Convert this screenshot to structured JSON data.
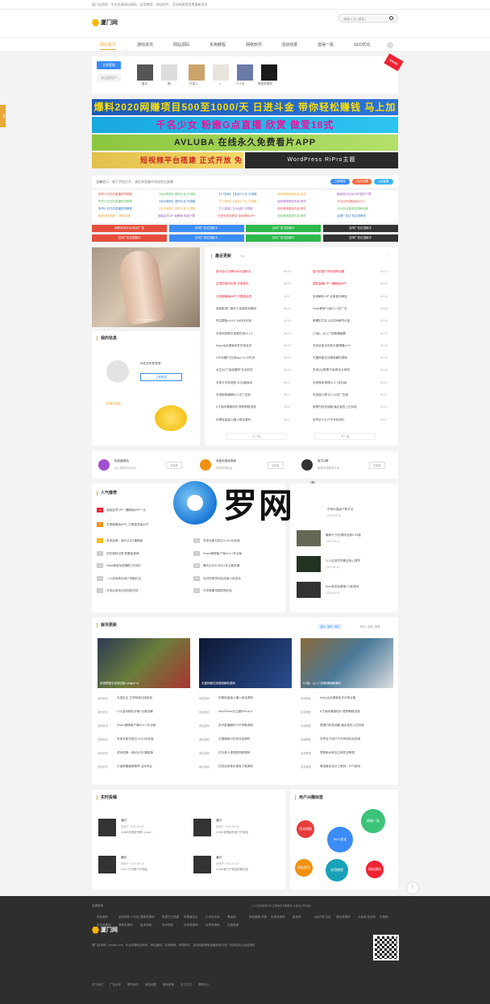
{
  "top": {
    "slogan": "厦门自资网 · 专业资源网站源码、实用教程、网站软件、活动线报等免费最新资讯"
  },
  "header": {
    "logo": "厦门网",
    "search_placeholder": "请输入词 (搜索)"
  },
  "nav": {
    "items": [
      "网站首页",
      "游戏资讯",
      "网站源码",
      "实用教程",
      "网络软件",
      "活动线报",
      "值得一看",
      "SEO优化"
    ]
  },
  "users": {
    "login": "立即登陆",
    "register": "未注册用户",
    "names": [
      "晨光",
      "楠",
      "付瑞人",
      "z",
      "十小天",
      "教育资源网"
    ],
    "ribbon": "最新推荐"
  },
  "banners": {
    "b1": "爆料2020网赚项目500至1000/天 日进斗金 带你轻松赚钱 马上加入",
    "b2": "千名少女 粉嫩G点直播 欣赏 做爱18式",
    "b3": "AVLUBA 在线永久免费看片APP",
    "b4_left": "短视频平台搭建 正式开放 免费申请 吧",
    "b4_right": "WordPress RiPro主题"
  },
  "notice": {
    "text": "温馨提示：便于手机打开，请在浏览器中添加到主屏幕",
    "pills": [
      "立即登陆",
      "QQ交流群",
      "QQ客服"
    ]
  },
  "links": [
    [
      "有赞小白白的直播带货教程",
      "【仙剑奇侠】进阶礼包 可领取",
      "【TC游戏】【全战TCG】可领取",
      "全网首席原创内容 精华",
      "新版双仑红包TMP插件下载"
    ],
    [
      "有赞小白白的直播带货教程",
      "【仙剑奇侠】进阶礼包 可领取",
      "【TC游戏】【全战TCG】可领取",
      "全网首席原创内容 精华",
      "20元Q币领取活动入口"
    ],
    [
      "有赞小白白的直播带货教程",
      "【仙剑奇侠】进阶礼包 可领取",
      "【TC游戏】【100级】可领取",
      "全网首席原创内容 精华",
      "2020年全新网站源码免费"
    ],
    [
      "盘前全网视频 一周免费赚",
      "超级会员VIP 破解版 免费下载",
      "天堂手游网首发 全网源码APP",
      "全网首席原创内容 精华",
      "全屏广告位 购买请联系"
    ]
  ],
  "adbtns": [
    "请联系站长QQ购买广告",
    "空闲广告位招租中",
    "空闲广告位招租中",
    "空闲广告位招租中",
    "空闲广告位招租中",
    "空闲广告位招租中",
    "空闲广告位招租中",
    "空闲广告位招租中"
  ],
  "recent": {
    "title": "最近更新",
    "count": "+10",
    "prev": "上一页",
    "next": "下一页",
    "left": [
      {
        "t": "新手怎么白嫖1000元福利礼",
        "d": "06-18"
      },
      {
        "t": "这里的网页出售 外观首先",
        "d": "06-18"
      },
      {
        "t": "天堂破解版APP 方便高品质",
        "d": "06-17"
      },
      {
        "t": "追新影视门事件介绍和如何解决",
        "d": "06-18"
      },
      {
        "t": "阿达模板v4.6.0.1683优化版",
        "d": "06-18"
      },
      {
        "t": "安卓消息聊天视频在线v2.2.1",
        "d": "06-18"
      },
      {
        "t": "Keep运动健身软件好用会员",
        "d": "06-18"
      },
      {
        "t": "GIF动图PC在线app v1.20在线",
        "d": "06-18"
      },
      {
        "t": "女生出门\"拒绝跟踪\"安全防范",
        "d": "06-18"
      },
      {
        "t": "安卓文字转语音 5G加速版本",
        "d": "06-17"
      },
      {
        "t": "安卓视频编辑v5.2去广告版",
        "d": "06-17"
      },
      {
        "t": "6寸身体健康知识 理财教程讲座",
        "d": "06-17"
      },
      {
        "t": "好看轻量级六姻人网站源码",
        "d": "06-17"
      }
    ],
    "right": [
      {
        "t": "嘉兴拍摄干货的推荐合集",
        "d": "06-18"
      },
      {
        "t": "国际直播VIP一键解锁APP",
        "d": "06-18"
      },
      {
        "t": "安卓解析VIP 全能音乐解锁",
        "d": "06-18"
      },
      {
        "t": "Keep健身TV版3.1.0去广告",
        "d": "06-18"
      },
      {
        "t": "刷爆实打实 QQ空间刷赞大量",
        "d": "06-18"
      },
      {
        "t": "CX版：从入门到精通破解",
        "d": "06-18"
      },
      {
        "t": "安卓全能手机助手管理器v2.9",
        "d": "06-18"
      },
      {
        "t": "天翼网盘在线搜索解析源码",
        "d": "06-18"
      },
      {
        "t": "安卓QQ表情气泡/群名片修改",
        "d": "06-18"
      },
      {
        "t": "安卓微信清理v5.2.7优化版",
        "d": "06-17"
      },
      {
        "t": "安卓超九神卡1.2.6去广告版",
        "d": "06-17"
      },
      {
        "t": "便携扫码查阅器 播出者的上位标准",
        "d": "06-17"
      },
      {
        "t": "世界全卡片户内号码优化",
        "d": "06-17"
      }
    ]
  },
  "myinfo": {
    "title": "我的信息",
    "guest": "你还没有登录哦~",
    "login": "立即登录",
    "contribute": "投稿拿奖励"
  },
  "features": [
    {
      "name": "知名度网站",
      "desc": "加入搜狗网站资讯",
      "btn": "去看看"
    },
    {
      "name": "淘宝天猫优惠券",
      "desc": "领券购物超省",
      "btn": "去看看"
    },
    {
      "name": "官方Q群",
      "desc": "聚焦资源群聊共享",
      "btn": "去看看"
    }
  ],
  "hot": {
    "title": "人气推荐",
    "items": [
      "超级会员VIP一键解锁APP一元",
      "天堂破解版APP_方便高质量APP",
      "资深品牌：面对点击2篇制版",
      "这些源码出售 配置量推荐",
      "Hello微信免费辅助7天测试",
      "一人游戏承包用户领取红包",
      "开发应用包在线网络在线",
      "安卓全能扫描王v4.8.2优化版",
      "Share微博客户端v3.5.1专业版",
      "腾讯云618.95元1年云服务器",
      "也好好教导你这些盘小说游戏",
      "平安健康领取购物补贴"
    ],
    "mascot": "罗网"
  },
  "right_news": [
    {
      "t": "宗师对高级下载方法",
      "d": "2019-08-16"
    },
    {
      "t": "最新FF分包源码全能2.34版",
      "d": "2019-08-16"
    },
    {
      "t": "人人必您的早餐目前心理学",
      "d": "2019-08-16"
    },
    {
      "t": "Epic商店免费赠＋2款游戏",
      "d": "2019-08-16"
    }
  ],
  "blocks": {
    "title": "板块更新",
    "tabs": [
      "游戏 / 源码 / 软件",
      "软件 / 资源 / 教程"
    ],
    "thumbs": [
      "英雄联盟手游测试版 League of",
      "天翼网盘在线搜索解析源码",
      "CX版：从入门到精通破解源码"
    ],
    "col1": [
      [
        "游戏资讯",
        "天涯社区 文学网络社团游戏"
      ],
      [
        "游戏资讯",
        "LOL游戏精彩对局+比赛详解"
      ],
      [
        "游戏资讯",
        "Share微博客户端v3.5.1专业版"
      ],
      [
        "游戏资讯",
        "安卓全能扫描王v4.8.2优化版"
      ],
      [
        "游戏资讯",
        "资深品牌：面对点击2篇制版"
      ],
      [
        "游戏资讯",
        "王者荣耀最新赛季 活动专区"
      ]
    ],
    "col2": [
      [
        "网站源码",
        "好看轻量级六姻人网站源码"
      ],
      [
        "网站源码",
        "WordPress日主题RiPro6.9"
      ],
      [
        "网站源码",
        "虎牙直播解析PHP获取源码"
      ],
      [
        "网站源码",
        "中国通用AI在线对话源码"
      ],
      [
        "网站源码",
        "仿抖音小视频短视频源码"
      ],
      [
        "网站源码",
        "在线全网音乐搜索下载源码"
      ]
    ],
    "col3": [
      [
        "实用教程",
        "Keep运动健身知识分享合集"
      ],
      [
        "实用教程",
        "6寸身体健康知识 理财教程讲座"
      ],
      [
        "实用教程",
        "便携扫码查阅器 播出者的上位标准"
      ],
      [
        "实用教程",
        "世界全卡用户户内号码优化使用"
      ],
      [
        "实用教程",
        "零基础AI商业应用完全教程"
      ],
      [
        "实用教程",
        "微信最全站长工程师：FPS游戏"
      ]
    ]
  },
  "posts": {
    "title": "实时投稿",
    "items": [
      {
        "n": "潘日",
        "d": "投稿于 2020-06-18",
        "t": "13:58 你的新专辑《Love…"
      },
      {
        "n": "潘日",
        "d": "投稿于 2020-06-18",
        "t": "13:58 我的新作品门户网站"
      },
      {
        "n": "潘日",
        "d": "投稿于 2020-06-18",
        "t": "13:11 打开新门户网站…"
      },
      {
        "n": "潘日",
        "d": "投稿于 2020-06-18",
        "t": "13:58 新门户网站的新内容"
      }
    ]
  },
  "tags": {
    "title": "用户兴趣标签",
    "items": [
      "活动线报",
      "网络一条",
      "SEO优化",
      "网站资讯",
      "实用教程",
      "网站源码"
    ]
  },
  "footer": {
    "friend": "友情链接：",
    "friend_note": "（入门全新资源分享 正常情况 长期有效 以自动上传为准）",
    "links": [
      "网站源码",
      "站长网络 小白站",
      "搜索资源网",
      "阿里巴巴资源",
      "阿里香站长",
      "小本站长网",
      "黑话网",
      "网站模板 开源",
      "优质资源网",
      "影视网",
      "app开发 社区",
      "蓝色资源网",
      "大游戏 站长网",
      "牛图网",
      "风铃资源网",
      "翡翠资源网",
      "技术领域",
      "技术导航",
      "技术资源网",
      "世界资源网",
      "中国资源"
    ],
    "logo": "厦门网",
    "desc": "厦门自资网（mbwb.com）专业资源网站资讯、网站源码、实用教程、网络软件、活动线报等免费最新资讯为广大网友热心免费提供",
    "bottom": [
      "关于我们",
      "广告合作",
      "联系我们",
      "网站地图",
      "隐私政策",
      "支付方式",
      "帮助中心"
    ]
  }
}
